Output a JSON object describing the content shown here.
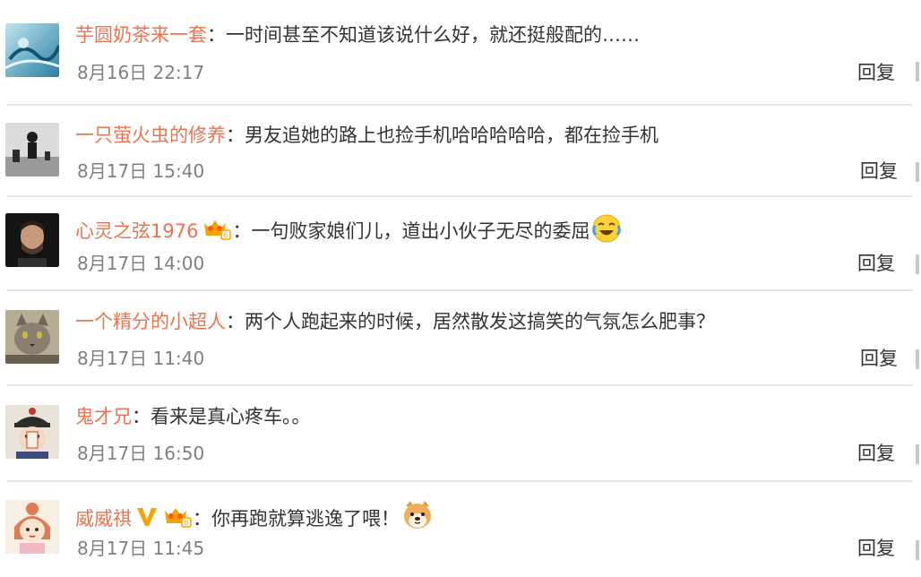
{
  "comments": [
    {
      "username": "芋圆奶茶来一套",
      "separator": "：",
      "text": "一时间甚至不知道该说什么好，就还挺般配的……",
      "time": "8月16日 22:17",
      "reply": "回复",
      "avatar_icon": "blue-ink-painting-avatar"
    },
    {
      "username": "一只萤火虫的修养",
      "separator": "：",
      "text": "男友追她的路上也捡手机哈哈哈哈哈，都在捡手机",
      "time": "8月17日 15:40",
      "reply": "回复",
      "avatar_icon": "bw-silhouette-avatar"
    },
    {
      "username": "心灵之弦1976",
      "separator": "：",
      "text": "一句败家娘们儿，道出小伙子无尽的委屈",
      "time": "8月17日 14:00",
      "reply": "回复",
      "avatar_icon": "bearded-man-avatar",
      "badges": [
        "vip-crown-icon"
      ],
      "emoji": "laugh-cry-emoji"
    },
    {
      "username": "一个精分的小超人",
      "separator": "：",
      "text": "两个人跑起来的时候，居然散发这搞笑的气氛怎么肥事？",
      "time": "8月17日 11:40",
      "reply": "回复",
      "avatar_icon": "cat-avatar"
    },
    {
      "username": "鬼才兄",
      "separator": "：",
      "text": "看来是真心疼车。。",
      "time": "8月17日 16:50",
      "reply": "回复",
      "avatar_icon": "qing-official-cartoon-avatar"
    },
    {
      "username": "威威祺",
      "separator": "：",
      "text": "你再跑就算逃逸了喂！",
      "time": "8月17日 11:45",
      "reply": "回复",
      "avatar_icon": "cartoon-girl-avatar",
      "badges": [
        "verified-v-icon",
        "vip-crown-icon"
      ],
      "emoji": "shiba-dog-emoji"
    }
  ],
  "colors": {
    "username": "#eb7350",
    "text": "#333333",
    "time": "#808080",
    "divider": "#e4e4e4",
    "badge_gold": "#f7a400"
  }
}
